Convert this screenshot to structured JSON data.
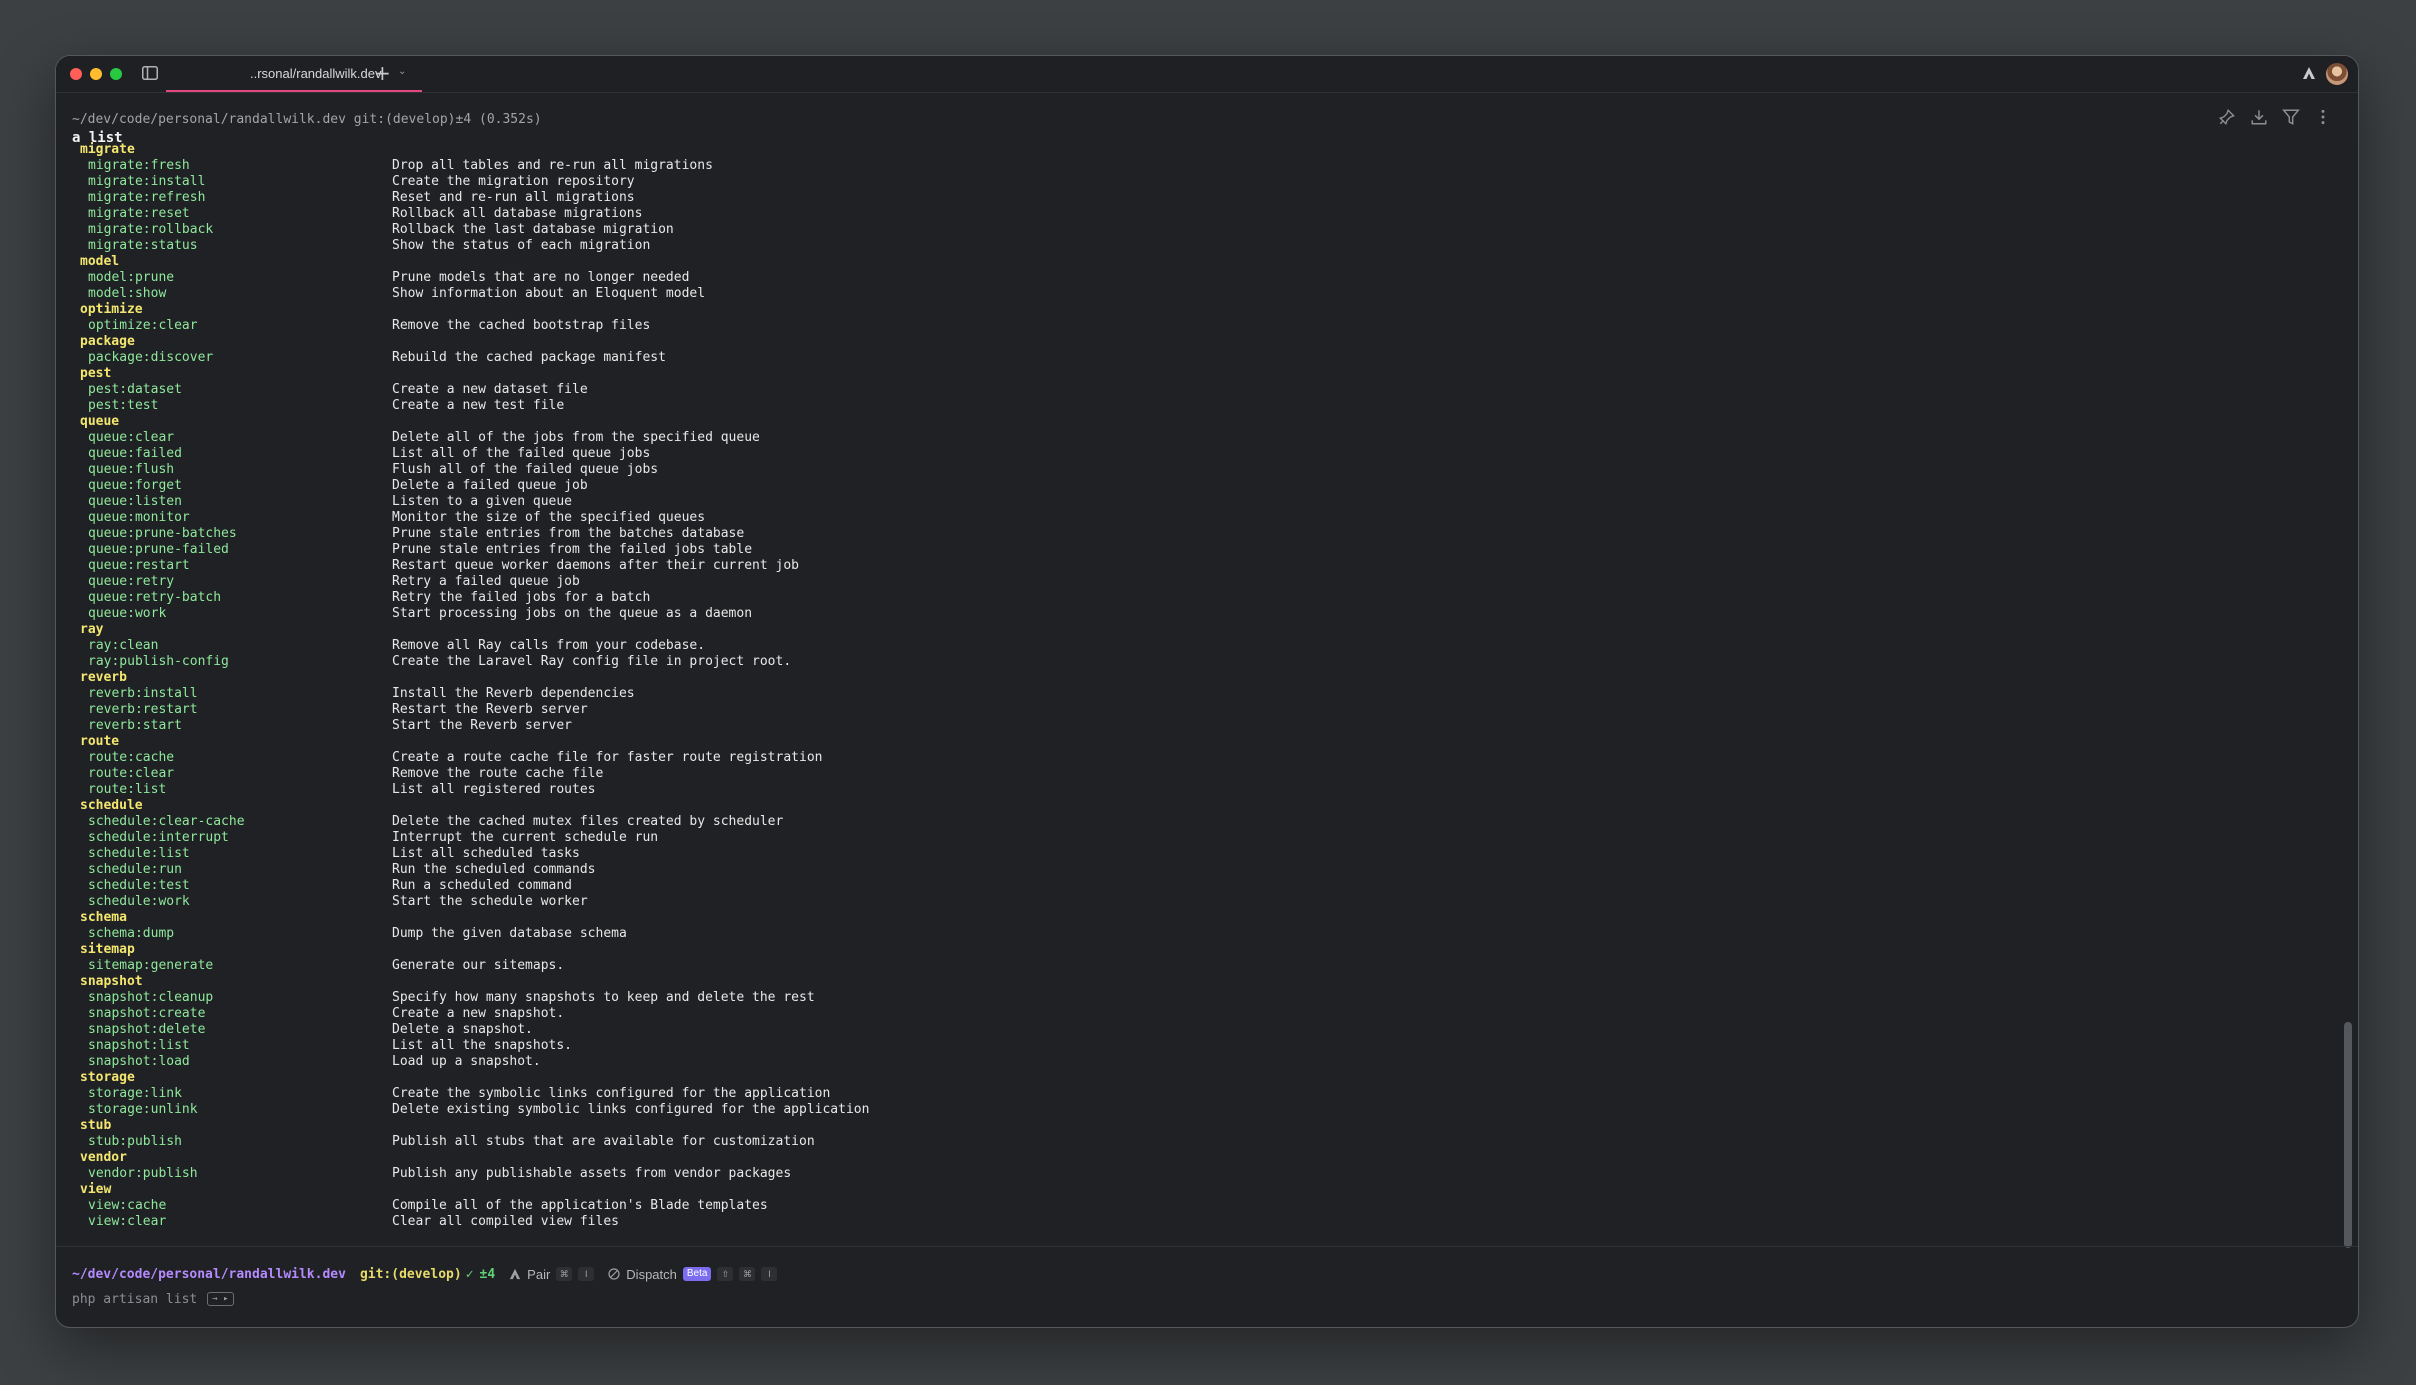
{
  "window": {
    "tab_title": "..rsonal/randallwilk.dev"
  },
  "prompt": {
    "path_line": "~/dev/code/personal/randallwilk.dev git:(develop)±4 (0.352s)",
    "command": "a list"
  },
  "output": {
    "rows": [
      {
        "ns": "migrate"
      },
      {
        "name": "migrate:fresh",
        "desc": "Drop all tables and re-run all migrations"
      },
      {
        "name": "migrate:install",
        "desc": "Create the migration repository"
      },
      {
        "name": "migrate:refresh",
        "desc": "Reset and re-run all migrations"
      },
      {
        "name": "migrate:reset",
        "desc": "Rollback all database migrations"
      },
      {
        "name": "migrate:rollback",
        "desc": "Rollback the last database migration"
      },
      {
        "name": "migrate:status",
        "desc": "Show the status of each migration"
      },
      {
        "ns": "model"
      },
      {
        "name": "model:prune",
        "desc": "Prune models that are no longer needed"
      },
      {
        "name": "model:show",
        "desc": "Show information about an Eloquent model"
      },
      {
        "ns": "optimize"
      },
      {
        "name": "optimize:clear",
        "desc": "Remove the cached bootstrap files"
      },
      {
        "ns": "package"
      },
      {
        "name": "package:discover",
        "desc": "Rebuild the cached package manifest"
      },
      {
        "ns": "pest"
      },
      {
        "name": "pest:dataset",
        "desc": "Create a new dataset file"
      },
      {
        "name": "pest:test",
        "desc": "Create a new test file"
      },
      {
        "ns": "queue"
      },
      {
        "name": "queue:clear",
        "desc": "Delete all of the jobs from the specified queue"
      },
      {
        "name": "queue:failed",
        "desc": "List all of the failed queue jobs"
      },
      {
        "name": "queue:flush",
        "desc": "Flush all of the failed queue jobs"
      },
      {
        "name": "queue:forget",
        "desc": "Delete a failed queue job"
      },
      {
        "name": "queue:listen",
        "desc": "Listen to a given queue"
      },
      {
        "name": "queue:monitor",
        "desc": "Monitor the size of the specified queues"
      },
      {
        "name": "queue:prune-batches",
        "desc": "Prune stale entries from the batches database"
      },
      {
        "name": "queue:prune-failed",
        "desc": "Prune stale entries from the failed jobs table"
      },
      {
        "name": "queue:restart",
        "desc": "Restart queue worker daemons after their current job"
      },
      {
        "name": "queue:retry",
        "desc": "Retry a failed queue job"
      },
      {
        "name": "queue:retry-batch",
        "desc": "Retry the failed jobs for a batch"
      },
      {
        "name": "queue:work",
        "desc": "Start processing jobs on the queue as a daemon"
      },
      {
        "ns": "ray"
      },
      {
        "name": "ray:clean",
        "desc": "Remove all Ray calls from your codebase."
      },
      {
        "name": "ray:publish-config",
        "desc": "Create the Laravel Ray config file in project root."
      },
      {
        "ns": "reverb"
      },
      {
        "name": "reverb:install",
        "desc": "Install the Reverb dependencies"
      },
      {
        "name": "reverb:restart",
        "desc": "Restart the Reverb server"
      },
      {
        "name": "reverb:start",
        "desc": "Start the Reverb server"
      },
      {
        "ns": "route"
      },
      {
        "name": "route:cache",
        "desc": "Create a route cache file for faster route registration"
      },
      {
        "name": "route:clear",
        "desc": "Remove the route cache file"
      },
      {
        "name": "route:list",
        "desc": "List all registered routes"
      },
      {
        "ns": "schedule"
      },
      {
        "name": "schedule:clear-cache",
        "desc": "Delete the cached mutex files created by scheduler"
      },
      {
        "name": "schedule:interrupt",
        "desc": "Interrupt the current schedule run"
      },
      {
        "name": "schedule:list",
        "desc": "List all scheduled tasks"
      },
      {
        "name": "schedule:run",
        "desc": "Run the scheduled commands"
      },
      {
        "name": "schedule:test",
        "desc": "Run a scheduled command"
      },
      {
        "name": "schedule:work",
        "desc": "Start the schedule worker"
      },
      {
        "ns": "schema"
      },
      {
        "name": "schema:dump",
        "desc": "Dump the given database schema"
      },
      {
        "ns": "sitemap"
      },
      {
        "name": "sitemap:generate",
        "desc": "Generate our sitemaps."
      },
      {
        "ns": "snapshot"
      },
      {
        "name": "snapshot:cleanup",
        "desc": "Specify how many snapshots to keep and delete the rest"
      },
      {
        "name": "snapshot:create",
        "desc": "Create a new snapshot."
      },
      {
        "name": "snapshot:delete",
        "desc": "Delete a snapshot."
      },
      {
        "name": "snapshot:list",
        "desc": "List all the snapshots."
      },
      {
        "name": "snapshot:load",
        "desc": "Load up a snapshot."
      },
      {
        "ns": "storage"
      },
      {
        "name": "storage:link",
        "desc": "Create the symbolic links configured for the application"
      },
      {
        "name": "storage:unlink",
        "desc": "Delete existing symbolic links configured for the application"
      },
      {
        "ns": "stub"
      },
      {
        "name": "stub:publish",
        "desc": "Publish all stubs that are available for customization"
      },
      {
        "ns": "vendor"
      },
      {
        "name": "vendor:publish",
        "desc": "Publish any publishable assets from vendor packages"
      },
      {
        "ns": "view"
      },
      {
        "name": "view:cache",
        "desc": "Compile all of the application's Blade templates"
      },
      {
        "name": "view:clear",
        "desc": "Clear all compiled view files"
      }
    ]
  },
  "statusbar": {
    "path": "~/dev/code/personal/randallwilk.dev",
    "git": "git:(develop)",
    "check": "✓",
    "changes": "±4",
    "pair_label": "Pair",
    "dispatch_label": "Dispatch",
    "beta_label": "Beta",
    "keys": {
      "cmd": "⌘",
      "i": "I",
      "shift": "⇧"
    }
  },
  "input": {
    "placeholder": "php artisan list",
    "hint_key": "→ ▸"
  },
  "colors": {
    "accent_tab": "#e3497e",
    "namespace": "#f3e770",
    "command": "#8ee99c",
    "status_path": "#b58aff"
  }
}
